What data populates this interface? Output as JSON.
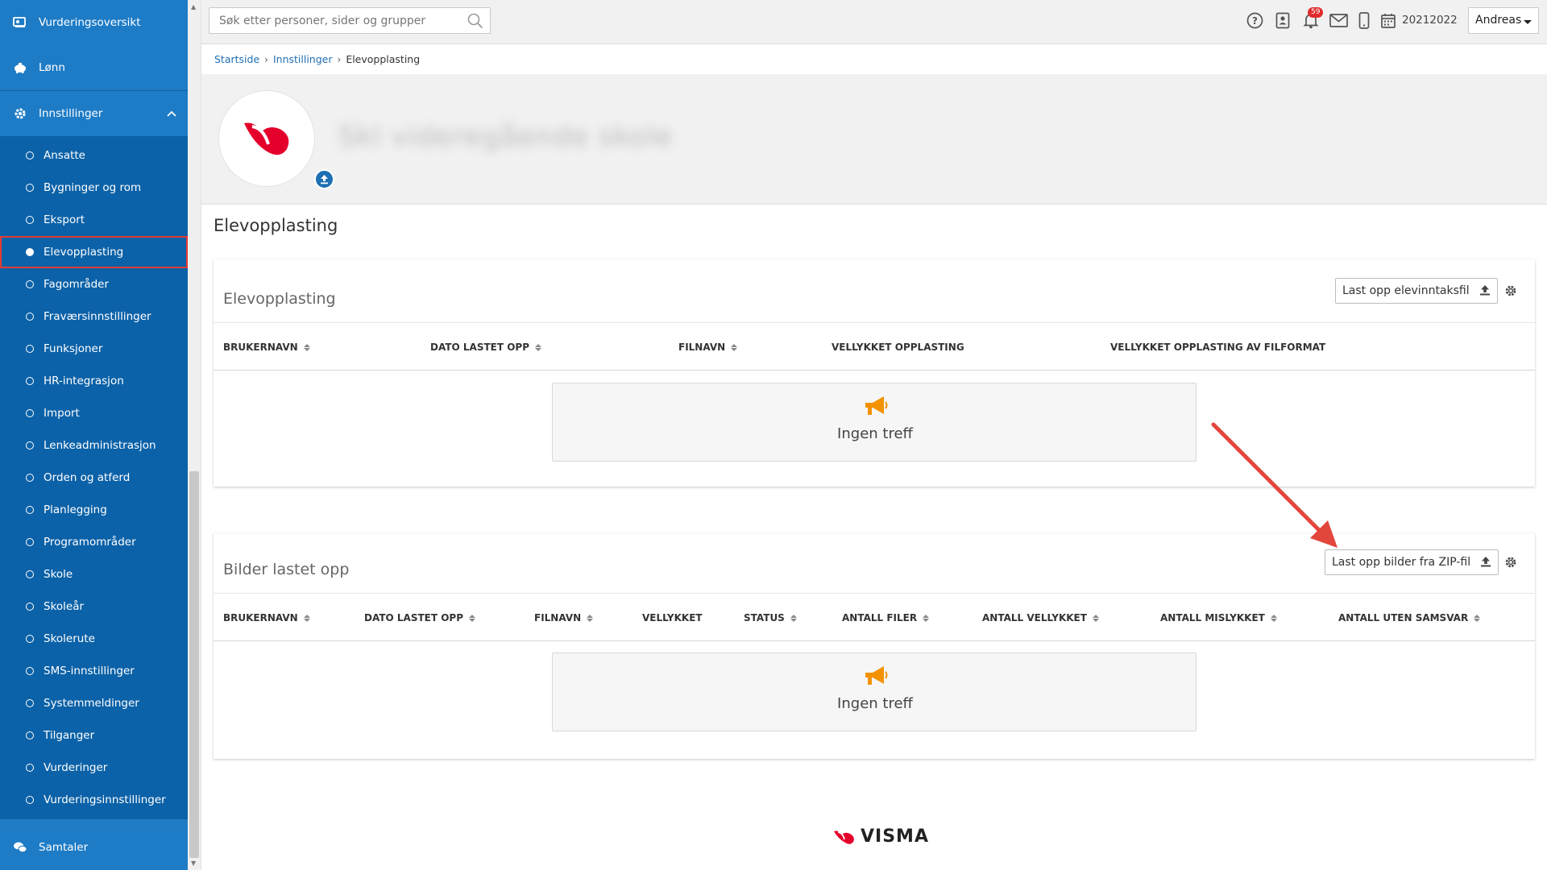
{
  "sidebar": {
    "top_items": [
      {
        "label": "Vurderingsoversikt",
        "icon": "assessment-icon"
      },
      {
        "label": "Lønn",
        "icon": "piggy-bank-icon"
      }
    ],
    "settings": {
      "label": "Innstillinger",
      "icon": "gear-icon",
      "expanded": true
    },
    "sub_items": [
      {
        "label": "Ansatte"
      },
      {
        "label": "Bygninger og rom"
      },
      {
        "label": "Eksport"
      },
      {
        "label": "Elevopplasting",
        "active": true
      },
      {
        "label": "Fagområder"
      },
      {
        "label": "Fraværsinnstillinger"
      },
      {
        "label": "Funksjoner"
      },
      {
        "label": "HR-integrasjon"
      },
      {
        "label": "Import"
      },
      {
        "label": "Lenkeadministrasjon"
      },
      {
        "label": "Orden og atferd"
      },
      {
        "label": "Planlegging"
      },
      {
        "label": "Programområder"
      },
      {
        "label": "Skole"
      },
      {
        "label": "Skoleår"
      },
      {
        "label": "Skolerute"
      },
      {
        "label": "SMS-innstillinger"
      },
      {
        "label": "Systemmeldinger"
      },
      {
        "label": "Tilganger"
      },
      {
        "label": "Vurderinger"
      },
      {
        "label": "Vurderingsinnstillinger"
      }
    ],
    "bottom_item": {
      "label": "Samtaler",
      "icon": "chat-icon"
    }
  },
  "topbar": {
    "search_placeholder": "Søk etter personer, sider og grupper",
    "notification_count": "59",
    "school_year": "20212022",
    "user_name": "Andreas"
  },
  "breadcrumb": [
    {
      "label": "Startside",
      "link": true
    },
    {
      "label": "Innstillinger",
      "link": true
    },
    {
      "label": "Elevopplasting",
      "link": false
    }
  ],
  "hero": {
    "school_name": "Skl videregående skole"
  },
  "page_title": "Elevopplasting",
  "panels": [
    {
      "title": "Elevopplasting",
      "button_label": "Last opp elevinntaksfil",
      "columns": [
        {
          "label": "BRUKERNAVN",
          "sortable": true
        },
        {
          "label": "DATO LASTET OPP",
          "sortable": true
        },
        {
          "label": "FILNAVN",
          "sortable": true
        },
        {
          "label": "VELLYKKET OPPLASTING",
          "sortable": false
        },
        {
          "label": "VELLYKKET OPPLASTING AV FILFORMAT",
          "sortable": false
        }
      ],
      "empty_text": "Ingen treff"
    },
    {
      "title": "Bilder lastet opp",
      "button_label": "Last opp bilder fra ZIP-fil",
      "columns": [
        {
          "label": "BRUKERNAVN",
          "sortable": true
        },
        {
          "label": "DATO LASTET OPP",
          "sortable": true
        },
        {
          "label": "FILNAVN",
          "sortable": true
        },
        {
          "label": "VELLYKKET",
          "sortable": false
        },
        {
          "label": "STATUS",
          "sortable": true
        },
        {
          "label": "ANTALL FILER",
          "sortable": true
        },
        {
          "label": "ANTALL VELLYKKET",
          "sortable": true
        },
        {
          "label": "ANTALL MISLYKKET",
          "sortable": true
        },
        {
          "label": "ANTALL UTEN SAMSVAR",
          "sortable": true
        }
      ],
      "empty_text": "Ingen treff"
    }
  ],
  "footer": {
    "brand": "VISMA"
  },
  "colors": {
    "sidebar": "#1f7cc4",
    "sidebar_sub": "#0c62a8",
    "highlight": "#e53935",
    "link": "#1e6fb3",
    "accent_orange": "#f39200",
    "visma_red": "#e4002b"
  }
}
